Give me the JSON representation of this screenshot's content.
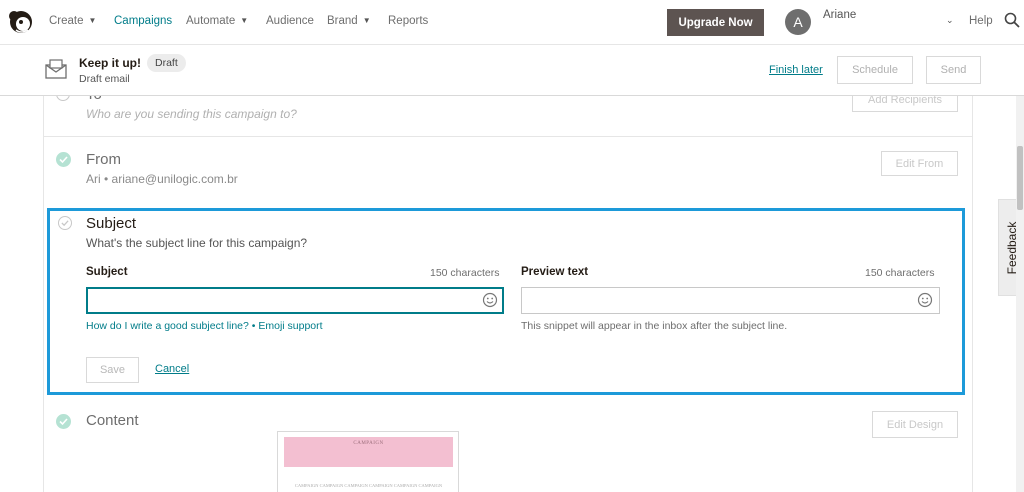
{
  "nav": {
    "items": [
      {
        "label": "Create",
        "has_dropdown": true,
        "active": false
      },
      {
        "label": "Campaigns",
        "has_dropdown": false,
        "active": true
      },
      {
        "label": "Automate",
        "has_dropdown": true,
        "active": false
      },
      {
        "label": "Audience",
        "has_dropdown": false,
        "active": false
      },
      {
        "label": "Brand",
        "has_dropdown": true,
        "active": false
      },
      {
        "label": "Reports",
        "has_dropdown": false,
        "active": false
      }
    ],
    "upgrade_label": "Upgrade Now",
    "avatar_initial": "A",
    "username": "Ariane",
    "help_label": "Help"
  },
  "campaign": {
    "title": "Keep it up!",
    "status_badge": "Draft",
    "subtitle": "Draft email",
    "finish_later": "Finish later",
    "schedule_label": "Schedule",
    "send_label": "Send"
  },
  "sections": {
    "to": {
      "title": "To",
      "description": "Who are you sending this campaign to?",
      "action": "Add Recipients"
    },
    "from": {
      "title": "From",
      "description": "Ari • ariane@unilogic.com.br",
      "action": "Edit From"
    },
    "subject": {
      "title": "Subject",
      "description": "What's the subject line for this campaign?",
      "subject_label": "Subject",
      "subject_count": "150 characters",
      "subject_value": "",
      "preview_label": "Preview text",
      "preview_count": "150 characters",
      "preview_value": "",
      "help_link": "How do I write a good subject line? • Emoji support",
      "preview_hint": "This snippet will appear in the inbox after the subject line.",
      "save_label": "Save",
      "cancel_label": "Cancel"
    },
    "content": {
      "title": "Content",
      "action": "Edit Design"
    }
  },
  "feedback_label": "Feedback",
  "colors": {
    "accent": "#007c89",
    "focus_border": "#1d9ad9",
    "upgrade_bg": "#5d5451",
    "complete_check": "#b5e2d3"
  }
}
